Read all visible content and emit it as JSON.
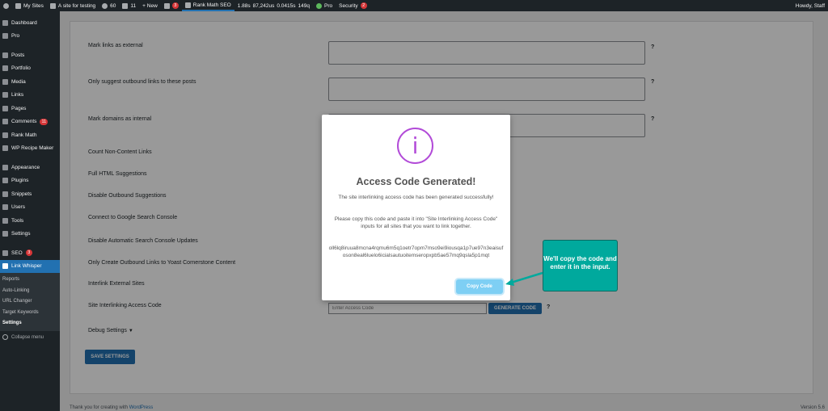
{
  "adminbar": {
    "my_sites": "My Sites",
    "site_name": "A site for testing",
    "updates_count": "60",
    "comments_count": "11",
    "new_label": "+ New",
    "yoast_badge": "3",
    "rank_math": "Rank Math SEO",
    "perf1": "1.88s",
    "perf2": "87,242us",
    "perf3": "0.0415s",
    "perf4": "149q",
    "pro": "Pro",
    "security": "Security",
    "security_badge": "2",
    "howdy": "Howdy, Staff"
  },
  "sidebar": {
    "items": [
      {
        "label": "Dashboard",
        "icon": "dashboard-icon"
      },
      {
        "label": "Pro",
        "icon": "pro-icon"
      },
      {
        "label": "Posts",
        "icon": "posts-icon"
      },
      {
        "label": "Portfolio",
        "icon": "portfolio-icon"
      },
      {
        "label": "Media",
        "icon": "media-icon"
      },
      {
        "label": "Links",
        "icon": "links-icon"
      },
      {
        "label": "Pages",
        "icon": "pages-icon"
      },
      {
        "label": "Comments",
        "icon": "comments-icon",
        "badge": "11"
      },
      {
        "label": "Rank Math",
        "icon": "rank-math-icon"
      },
      {
        "label": "WP Recipe Maker",
        "icon": "recipe-icon"
      },
      {
        "label": "Appearance",
        "icon": "appearance-icon"
      },
      {
        "label": "Plugins",
        "icon": "plugins-icon"
      },
      {
        "label": "Snippets",
        "icon": "snippets-icon"
      },
      {
        "label": "Users",
        "icon": "users-icon"
      },
      {
        "label": "Tools",
        "icon": "tools-icon"
      },
      {
        "label": "Settings",
        "icon": "settings-icon"
      },
      {
        "label": "SEO",
        "icon": "seo-icon",
        "badge": "3"
      },
      {
        "label": "Link Whisper",
        "icon": "link-whisper-icon"
      }
    ],
    "submenu": [
      "Reports",
      "Auto-Linking",
      "URL Changer",
      "Target Keywords",
      "Settings"
    ],
    "collapse": "Collapse menu"
  },
  "settings": {
    "mark_external": "Mark links as external",
    "only_suggest": "Only suggest outbound links to these posts",
    "mark_internal": "Mark domains as internal",
    "count_non_content": "Count Non-Content Links",
    "full_html": "Full HTML Suggestions",
    "disable_outbound": "Disable Outbound Suggestions",
    "connect_gsc": "Connect to Google Search Console",
    "disable_auto_gsc": "Disable Automatic Search Console Updates",
    "only_cornerstone": "Only Create Outbound Links to Yoast Cornerstone Content",
    "interlink_external": "Interlink External Sites",
    "access_code_label": "Site Interlinking Access Code",
    "access_code_placeholder": "Enter Access Code",
    "generate_code": "GENERATE CODE",
    "debug_settings": "Debug Settings",
    "save_settings": "SAVE SETTINGS",
    "help": "?"
  },
  "footer": {
    "thanks_prefix": "Thank you for creating with ",
    "thanks_link": "WordPress",
    "version": "Version 5.6"
  },
  "modal": {
    "icon_glyph": "i",
    "title": "Access Code Generated!",
    "line1": "The site interlinking access code has been generated successfully!",
    "line2": "Please copy this code and paste it into \"Site Interlinking Access Code\" inputs for all sites that you want to link together.",
    "code": "oll6lq8iruua8mcna4rqmu6m5q1oetr7opm7mso9ei9iousqa1p7ue97n3eaisufoson8eal6luelo6icialsautuoitemseropxpb5ae57mq9qsla5p1mqt",
    "copy_button": "Copy Code"
  },
  "callout": {
    "text": "We'll copy the code and enter it in the input."
  },
  "colors": {
    "accent": "#2271b1",
    "modal_icon": "#b24bd8",
    "copy_button": "#7ecff4",
    "callout": "#00a99d"
  }
}
